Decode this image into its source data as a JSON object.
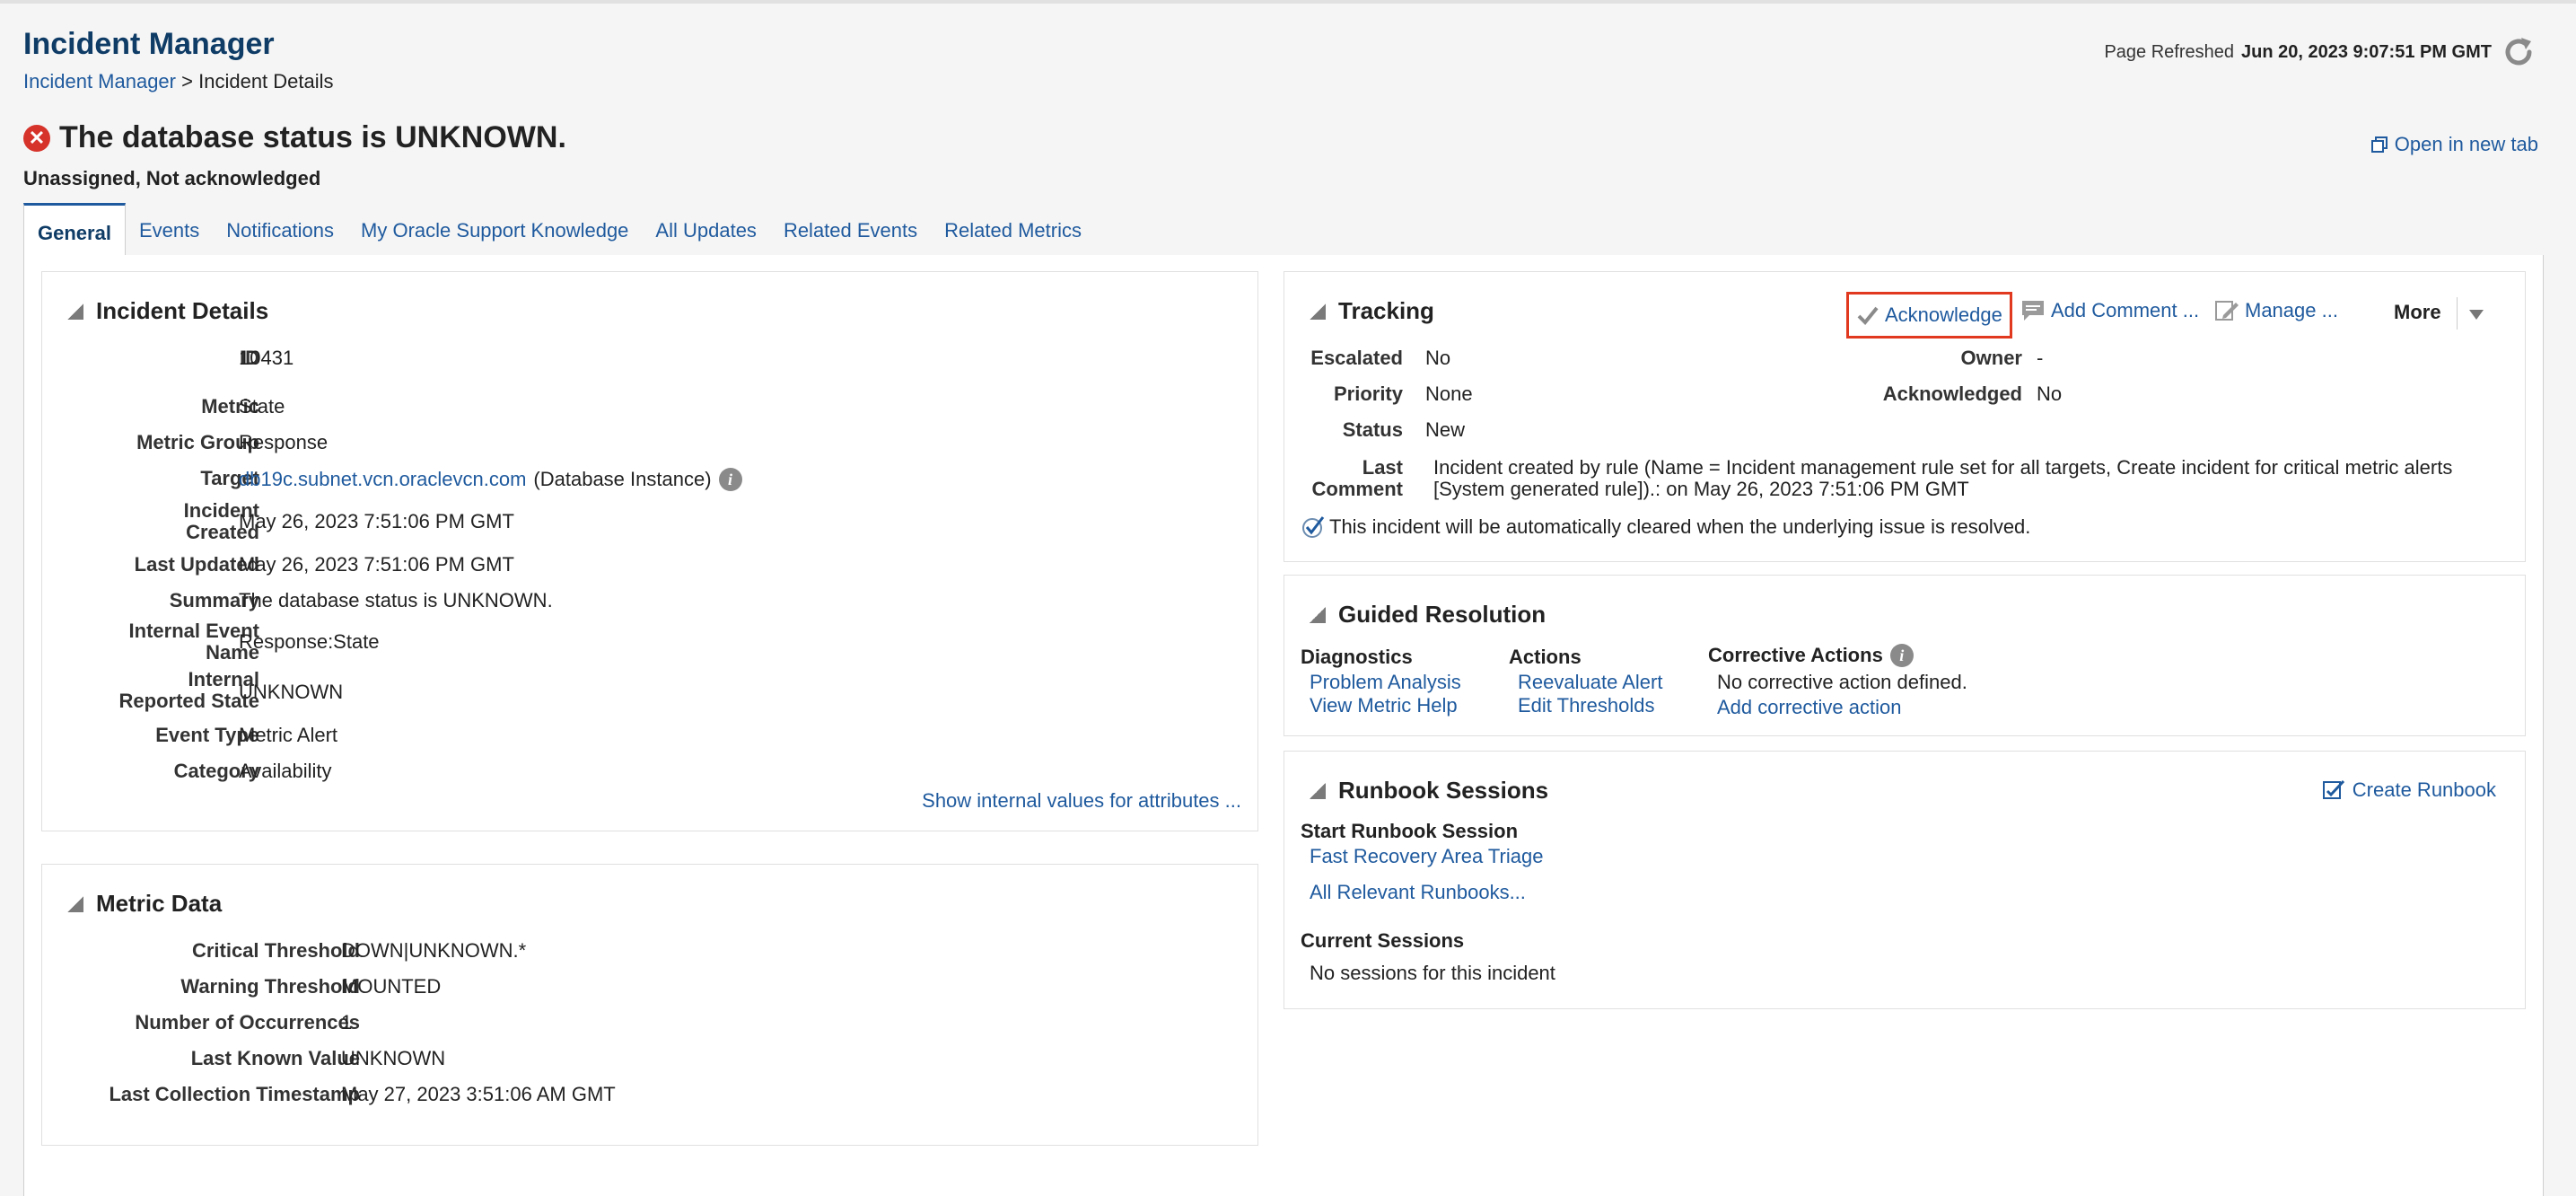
{
  "app": {
    "title": "Incident Manager"
  },
  "breadcrumb": {
    "root": "Incident Manager",
    "separator": ">",
    "current": "Incident Details"
  },
  "refresh": {
    "label": "Page Refreshed",
    "timestamp": "Jun 20, 2023 9:07:51 PM GMT"
  },
  "headline": {
    "text": "The database status is UNKNOWN.",
    "status": "Unassigned, Not acknowledged",
    "open_new_tab": "Open in new tab"
  },
  "tabs": [
    "General",
    "Events",
    "Notifications",
    "My Oracle Support Knowledge",
    "All Updates",
    "Related Events",
    "Related Metrics"
  ],
  "incident_details": {
    "title": "Incident Details",
    "fields": {
      "id": {
        "label": "ID",
        "value": "10431"
      },
      "metric": {
        "label": "Metric",
        "value": "State"
      },
      "metric_group": {
        "label": "Metric Group",
        "value": "Response"
      },
      "target": {
        "label": "Target",
        "value": "db19c.subnet.vcn.oraclevcn.com",
        "type": "(Database Instance)"
      },
      "incident_created": {
        "label_1": "Incident",
        "label_2": "Created",
        "value": "May 26, 2023 7:51:06 PM GMT"
      },
      "last_updated": {
        "label": "Last Updated",
        "value": "May 26, 2023 7:51:06 PM GMT"
      },
      "summary": {
        "label": "Summary",
        "value": "The database status is UNKNOWN."
      },
      "internal_event_name": {
        "label_1": "Internal Event",
        "label_2": "Name",
        "value": "Response:State"
      },
      "internal_reported_state": {
        "label_1": "Internal",
        "label_2": "Reported State",
        "value": "UNKNOWN"
      },
      "event_type": {
        "label": "Event Type",
        "value": "Metric Alert"
      },
      "category": {
        "label": "Category",
        "value": "Availability"
      }
    },
    "show_internal": "Show internal values for attributes ..."
  },
  "metric_data": {
    "title": "Metric Data",
    "fields": {
      "critical": {
        "label": "Critical Threshold",
        "value": "DOWN|UNKNOWN.*"
      },
      "warning": {
        "label": "Warning Threshold",
        "value": "MOUNTED"
      },
      "occurrences": {
        "label": "Number of Occurrences",
        "value": "1"
      },
      "last_known": {
        "label": "Last Known Value",
        "value": "UNKNOWN"
      },
      "last_collection": {
        "label": "Last Collection Timestamp",
        "value": "May 27, 2023 3:51:06 AM GMT"
      }
    }
  },
  "tracking": {
    "title": "Tracking",
    "toolbar": {
      "acknowledge": "Acknowledge",
      "add_comment": "Add Comment ...",
      "manage": "Manage ...",
      "more": "More"
    },
    "escalated": {
      "label": "Escalated",
      "value": "No"
    },
    "priority": {
      "label": "Priority",
      "value": "None"
    },
    "status": {
      "label": "Status",
      "value": "New"
    },
    "owner": {
      "label": "Owner",
      "value": "-"
    },
    "acknowledged": {
      "label": "Acknowledged",
      "value": "No"
    },
    "last_comment": {
      "label_1": "Last",
      "label_2": "Comment",
      "line_1": "Incident created by rule (Name = Incident management rule set for all targets, Create incident for critical metric alerts",
      "line_2": "[System generated rule]).: on May 26, 2023 7:51:06 PM GMT"
    },
    "auto_clear": "This incident will be automatically cleared when the underlying issue is resolved."
  },
  "guided_resolution": {
    "title": "Guided Resolution",
    "diagnostics": {
      "header": "Diagnostics",
      "items": [
        "Problem Analysis",
        "View Metric Help"
      ]
    },
    "actions": {
      "header": "Actions",
      "items": [
        "Reevaluate Alert",
        "Edit Thresholds"
      ]
    },
    "corrective": {
      "header": "Corrective Actions",
      "none": "No corrective action defined.",
      "add": "Add corrective action"
    }
  },
  "runbook": {
    "title": "Runbook Sessions",
    "create": "Create Runbook",
    "start_header": "Start Runbook Session",
    "fast_recovery": "Fast Recovery Area Triage",
    "all_relevant": "All Relevant Runbooks...",
    "current_header": "Current Sessions",
    "no_sessions": "No sessions for this incident"
  },
  "colors": {
    "brand": "#0f3c66",
    "link": "#1f5a9e",
    "error": "#d6332b",
    "highlight_box": "#e0391f"
  }
}
